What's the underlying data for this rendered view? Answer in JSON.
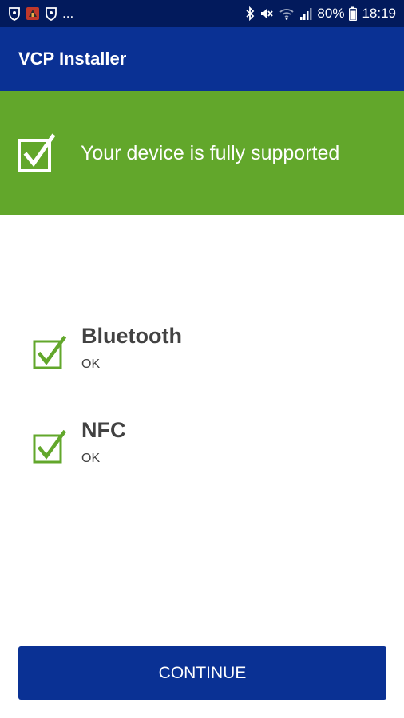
{
  "status_bar": {
    "notification_icons": [
      "shield-icon",
      "app-notification-icon",
      "shield-icon"
    ],
    "more_indicator": "...",
    "status_icons": [
      "bluetooth-icon",
      "mute-icon",
      "wifi-icon",
      "signal-icon"
    ],
    "battery": "80%",
    "time": "18:19"
  },
  "app_bar": {
    "title": "VCP Installer"
  },
  "banner": {
    "message": "Your device is fully supported",
    "color": "#62a72b"
  },
  "checks": [
    {
      "title": "Bluetooth",
      "status": "OK"
    },
    {
      "title": "NFC",
      "status": "OK"
    }
  ],
  "continue_button": {
    "label": "CONTINUE"
  },
  "colors": {
    "status_bar": "#021a5c",
    "primary": "#0a3194",
    "success": "#62a72b",
    "check_icon": "#62a72b",
    "text": "#424242"
  }
}
